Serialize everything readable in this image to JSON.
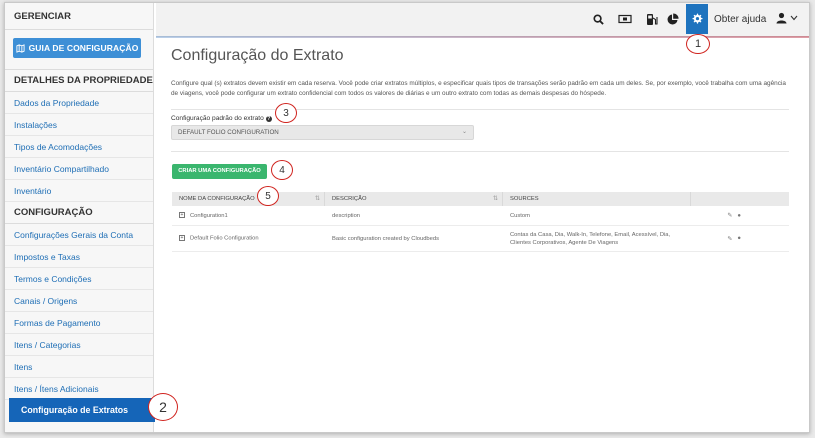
{
  "sidebar": {
    "header": "GERENCIAR",
    "guide_button": "GUIA DE CONFIGURAÇÃO",
    "section1": "DETALHES DA PROPRIEDADE",
    "items1": [
      "Dados da Propriedade",
      "Instalações",
      "Tipos de Acomodações",
      "Inventário Compartilhado",
      "Inventário"
    ],
    "section2": "CONFIGURAÇÃO",
    "items2": [
      "Configurações Gerais da Conta",
      "Impostos e Taxas",
      "Termos e Condições",
      "Canais / Origens",
      "Formas de Pagamento",
      "Itens / Categorias",
      "Itens",
      "Itens / Ítens Adicionais"
    ],
    "active_item": "Configuração de Extratos"
  },
  "topbar": {
    "help_label": "Obter ajuda",
    "icons": [
      "search-icon",
      "cash-icon",
      "gas-pump-icon",
      "pie-chart-icon",
      "gear-icon",
      "user-icon",
      "chevron-down-icon"
    ]
  },
  "main": {
    "title": "Configuração do Extrato",
    "description": "Configure qual (s) extratos devem existir em cada reserva. Você pode criar extratos múltiplos, e especificar quais tipos de transações serão padrão em cada um deles. Se, por exemplo, você trabalha com uma agência de viagens, você pode configurar um extrato confidencial com todos os valores de diárias e um outro extrato com todas as demais despesas do hóspede.",
    "field_label": "Configuração padrão do extrato",
    "select_value": "DEFAULT FOLIO CONFIGURATION",
    "create_button": "CRIAR UMA CONFIGURAÇÃO"
  },
  "table": {
    "headers": [
      "NOME DA CONFIGURAÇÃO",
      "DESCRIÇÃO",
      "SOURCES",
      ""
    ],
    "rows": [
      {
        "name": "Configuration1",
        "description": "description",
        "sources": "Custom"
      },
      {
        "name": "Default Folio Configuration",
        "description": "Basic configuration created by Cloudbeds",
        "sources": "Contas da Casa, Dia, Walk-In, Telefone, Email, Acessível, Dia, Clientes Corporativos, Agente De Viagens"
      }
    ]
  },
  "callouts": [
    "1",
    "2",
    "3",
    "4",
    "5"
  ],
  "colors": {
    "primary_blue": "#1565b8",
    "guide_blue": "#3d8fd6",
    "create_green": "#3ab66e",
    "callout_red": "#d0231e"
  }
}
